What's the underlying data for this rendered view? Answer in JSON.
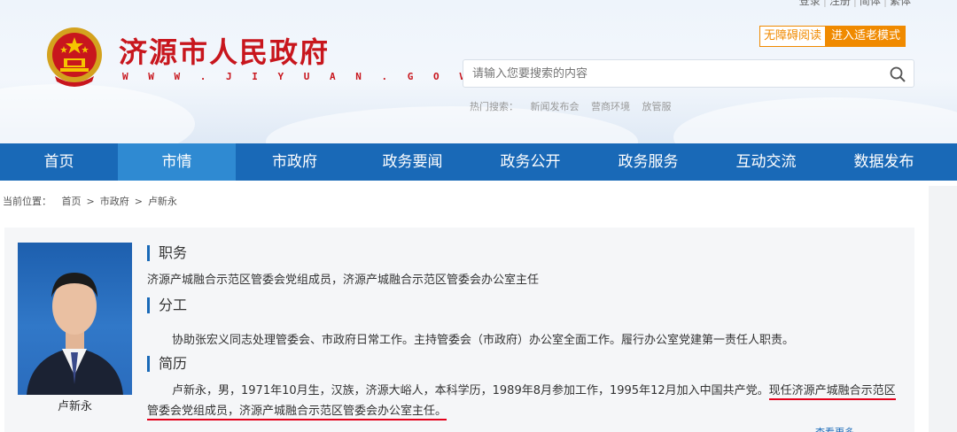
{
  "header": {
    "toplinks": [
      "登录",
      "注册",
      "简体",
      "繁体"
    ],
    "site_title": "济源市人民政府",
    "site_url": "W W W . J I Y U A N . G O V . C N",
    "accessibility_label": "无障碍阅读",
    "elder_mode_label": "进入适老模式",
    "search_placeholder": "请输入您要搜索的内容",
    "hot_label": "热门搜索：",
    "hot_terms": [
      "新闻发布会",
      "营商环境",
      "放管服"
    ]
  },
  "nav": {
    "items": [
      "首页",
      "市情",
      "市政府",
      "政务要闻",
      "政务公开",
      "政务服务",
      "互动交流",
      "数据发布"
    ],
    "active_index": 1
  },
  "breadcrumb": {
    "label": "当前位置：",
    "items": [
      "首页",
      "市政府",
      "卢新永"
    ],
    "separator": ">"
  },
  "profile": {
    "name": "卢新永",
    "duty_title": "职务",
    "duty_text": "济源产城融合示范区管委会党组成员，济源产城融合示范区管委会办公室主任",
    "division_title": "分工",
    "division_text": "协助张宏义同志处理管委会、市政府日常工作。主持管委会（市政府）办公室全面工作。履行办公室党建第一责任人职责。",
    "resume_title": "简历",
    "resume_text": "卢新永，男，1971年10月生，汉族，济源大峪人，本科学历，1989年8月参加工作，1995年12月加入中国共产党。",
    "resume_highlight": "现任济源产城融合示范区管委会党组成员，济源产城融合示范区管委会办公室主任。",
    "more_label": "查看更多"
  },
  "colors": {
    "brand_red": "#c8161d",
    "nav_blue": "#1969b7",
    "nav_active": "#2f8ad2",
    "orange": "#f08a00",
    "highlight_underline": "#e3001b"
  }
}
